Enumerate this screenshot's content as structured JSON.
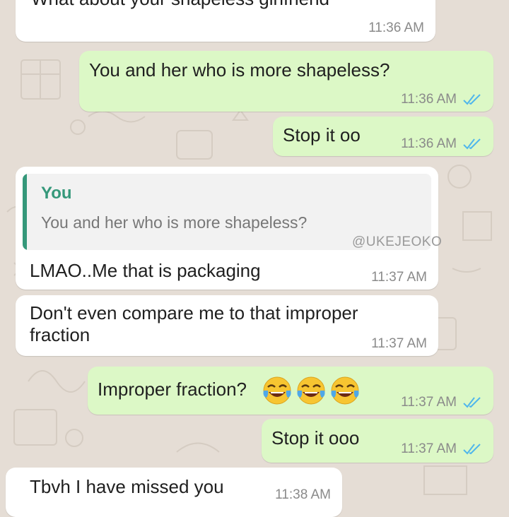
{
  "chat": {
    "messages": [
      {
        "id": "m1",
        "direction": "incoming",
        "text": "What about your shapeless girlfriend",
        "time": "11:36 AM"
      },
      {
        "id": "m2",
        "direction": "outgoing",
        "text": "You and her who is more shapeless?",
        "time": "11:36 AM",
        "status": "read"
      },
      {
        "id": "m3",
        "direction": "outgoing",
        "text": "Stop it oo",
        "time": "11:36 AM",
        "status": "read"
      },
      {
        "id": "m4",
        "direction": "incoming",
        "quote": {
          "author": "You",
          "text": "You and her who is more shapeless?"
        },
        "text": "LMAO..Me that is packaging",
        "time": "11:37 AM"
      },
      {
        "id": "m5",
        "direction": "incoming",
        "lines": [
          "Don't even compare me to that improper",
          "fraction"
        ],
        "time": "11:37 AM"
      },
      {
        "id": "m6",
        "direction": "outgoing",
        "text": "Improper fraction?",
        "emoji": [
          "face-with-tears-of-joy",
          "face-with-tears-of-joy",
          "face-with-tears-of-joy"
        ],
        "time": "11:37 AM",
        "status": "read"
      },
      {
        "id": "m7",
        "direction": "outgoing",
        "text": "Stop it ooo",
        "time": "11:37 AM",
        "status": "read"
      },
      {
        "id": "m8",
        "direction": "incoming",
        "text": "Tbvh I have missed you",
        "time": "11:38 AM"
      }
    ]
  },
  "watermark": "@UKEJEOKO",
  "colors": {
    "background": "#e5ddd5",
    "incoming_bubble": "#ffffff",
    "outgoing_bubble": "#dcf8c6",
    "read_ticks": "#4fb6ec",
    "quote_accent": "#35987a"
  }
}
